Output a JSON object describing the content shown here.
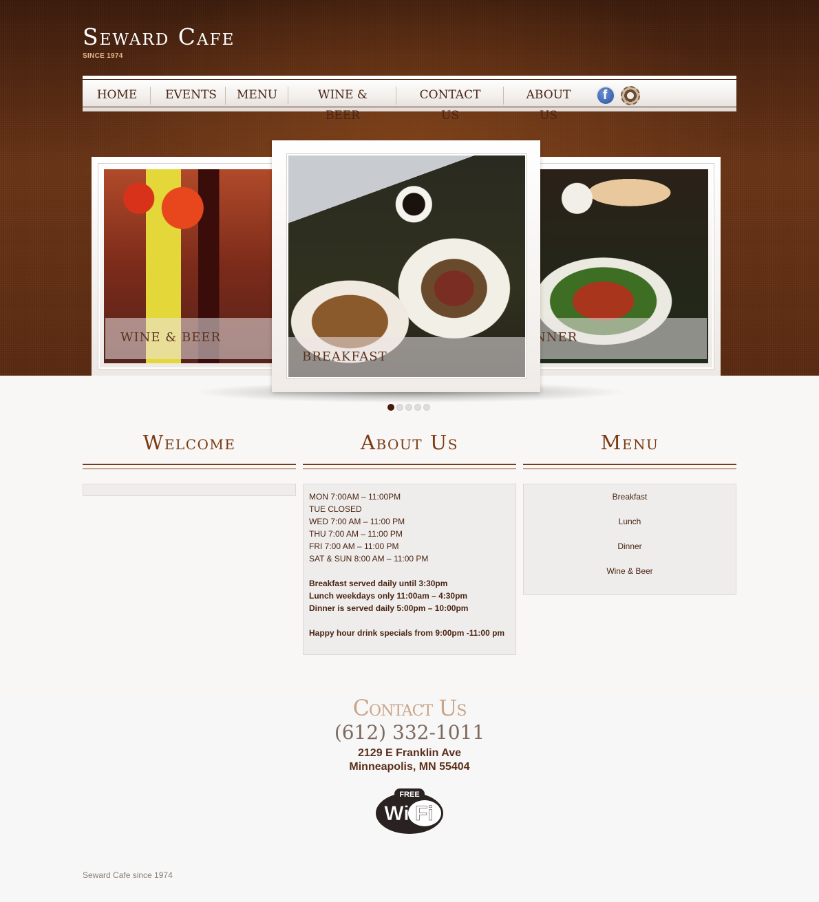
{
  "header": {
    "logo_text": "Seward Cafe",
    "logo_sub": "SINCE 1974"
  },
  "nav": {
    "items": [
      {
        "label": "HOME"
      },
      {
        "label": "EVENTS"
      },
      {
        "label": "MENU"
      },
      {
        "label": "WINE & BEER"
      },
      {
        "label": "CONTACT US"
      },
      {
        "label": "ABOUT US"
      }
    ],
    "social": [
      "facebook-icon",
      "instagram-icon"
    ]
  },
  "slider": {
    "left_label": "WINE & BEER",
    "center_label": "BREAKFAST",
    "right_label": "NNER",
    "dot_count": 5,
    "active_dot": 0
  },
  "welcome": {
    "title": "Welcome"
  },
  "about": {
    "title": "About Us",
    "hours": [
      "MON 7:00AM – 11:00PM",
      "TUE CLOSED",
      "WED 7:00 AM – 11:00 PM",
      "THU 7:00 AM – 11:00 PM",
      "FRI 7:00 AM – 11:00 PM",
      "SAT & SUN 8:00 AM – 11:00 PM"
    ],
    "meals": [
      "Breakfast served daily until 3:30pm",
      "Lunch weekdays only 11:00am – 4:30pm",
      "Dinner is served daily 5:00pm – 10:00pm"
    ],
    "happy_hour": "Happy hour drink specials from 9:00pm -11:00 pm"
  },
  "menu": {
    "title": "Menu",
    "items": [
      "Breakfast",
      "Lunch",
      "Dinner",
      "Wine & Beer"
    ]
  },
  "contact": {
    "title": "Contact Us",
    "phone": "(612) 332-1011",
    "address_line1": "2129 E Franklin Ave",
    "address_line2": "Minneapolis, MN 55404",
    "wifi_free": "FREE",
    "wifi_text": "Wi Fi"
  },
  "footer": {
    "copyright": "Seward Cafe since 1974"
  },
  "colors": {
    "brand_brown": "#7a3a12",
    "dark_brown": "#4a2414",
    "contact_tan": "#caa488"
  }
}
